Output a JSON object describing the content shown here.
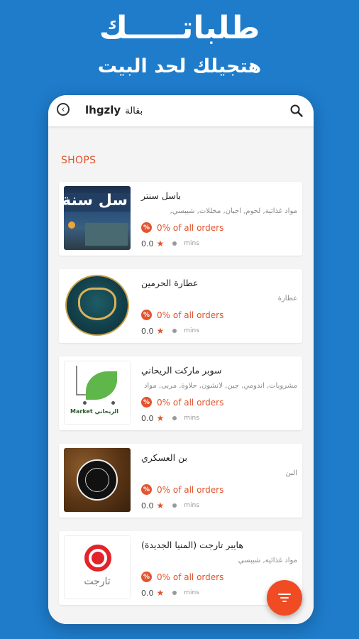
{
  "promo": {
    "headline": "طلباتـــــك",
    "subheadline": "هتجيلك لحد البيت"
  },
  "search": {
    "query_en": "lhgzly",
    "query_ar": "بقالة"
  },
  "section": {
    "title": "SHOPS"
  },
  "shops": [
    {
      "name": "باسل سنتر",
      "categories": "مواد غذائية, لحوم, اجبان, مخللات, شيبسي,",
      "offer": "0% of all orders",
      "offer_icon": "%",
      "rating": "0.0",
      "time_unit": "mins"
    },
    {
      "name": "عطارة الحرمين",
      "categories": "عطارة",
      "offer": "0% of all orders",
      "offer_icon": "%",
      "rating": "0.0",
      "time_unit": "mins"
    },
    {
      "name": "سوبر ماركت الريحاني",
      "categories": "مشروبات, اندومي, جبن, لانشون, حلاوة, مربى, مواد",
      "offer": "0% of all orders",
      "offer_icon": "%",
      "rating": "0.0",
      "time_unit": "mins"
    },
    {
      "name": "بن العسكري",
      "categories": "البن",
      "offer": "0% of all orders",
      "offer_icon": "%",
      "rating": "0.0",
      "time_unit": "mins"
    },
    {
      "name": "هايبر تارجت (المنيا الجديدة)",
      "categories": "مواد غذائية, شيبسي",
      "offer": "0% of all orders",
      "offer_icon": "%",
      "rating": "0.0",
      "time_unit": "mins"
    }
  ],
  "thumb_text": {
    "shop1": "سل سنة",
    "shop3_brand": "Market الريحاني",
    "shop5_brand": "تارجت"
  },
  "colors": {
    "background": "#1E7CCB",
    "accent": "#E2542E",
    "fab": "#F04B23"
  },
  "icons": {
    "back": "back-arrow-icon",
    "search": "search-icon",
    "offer": "percent-icon",
    "rating": "star-icon",
    "time": "clock-icon",
    "fab": "filter-icon"
  }
}
